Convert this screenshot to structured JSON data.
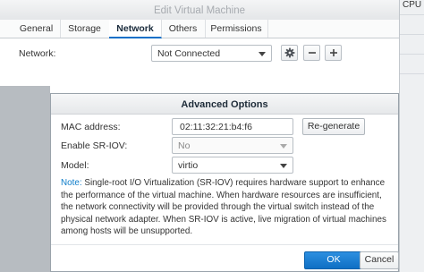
{
  "background_panel": {
    "label": "CPU"
  },
  "window": {
    "title": "Edit Virtual Machine",
    "tabs": [
      {
        "label": "General",
        "active": false
      },
      {
        "label": "Storage",
        "active": false
      },
      {
        "label": "Network",
        "active": true
      },
      {
        "label": "Others",
        "active": false
      },
      {
        "label": "Permissions",
        "active": false
      }
    ],
    "network": {
      "label": "Network:",
      "value": "Not Connected"
    },
    "icons": [
      "gear-icon",
      "minus-icon",
      "plus-icon"
    ]
  },
  "dialog": {
    "title": "Advanced Options",
    "mac": {
      "label": "MAC address:",
      "value": "02:11:32:21:b4:f6",
      "regenerate": "Re-generate"
    },
    "sriov": {
      "label": "Enable SR-IOV:",
      "value": "No"
    },
    "model": {
      "label": "Model:",
      "value": "virtio"
    },
    "note": {
      "prefix": "Note:",
      "text": "Single-root I/O Virtualization (SR-IOV) requires hardware support to enhance the performance of the virtual machine. When hardware resources are insufficient, the network connectivity will be provided through the virtual switch instead of the physical network adapter. When SR-IOV is active, live migration of virtual machines among hosts will be unsupported."
    },
    "ok": "OK",
    "cancel": "Cancel"
  },
  "colors": {
    "accent": "#0d6fc8",
    "note_prefix": "#0d7cc9",
    "ok_button": "#1a7fd6"
  }
}
